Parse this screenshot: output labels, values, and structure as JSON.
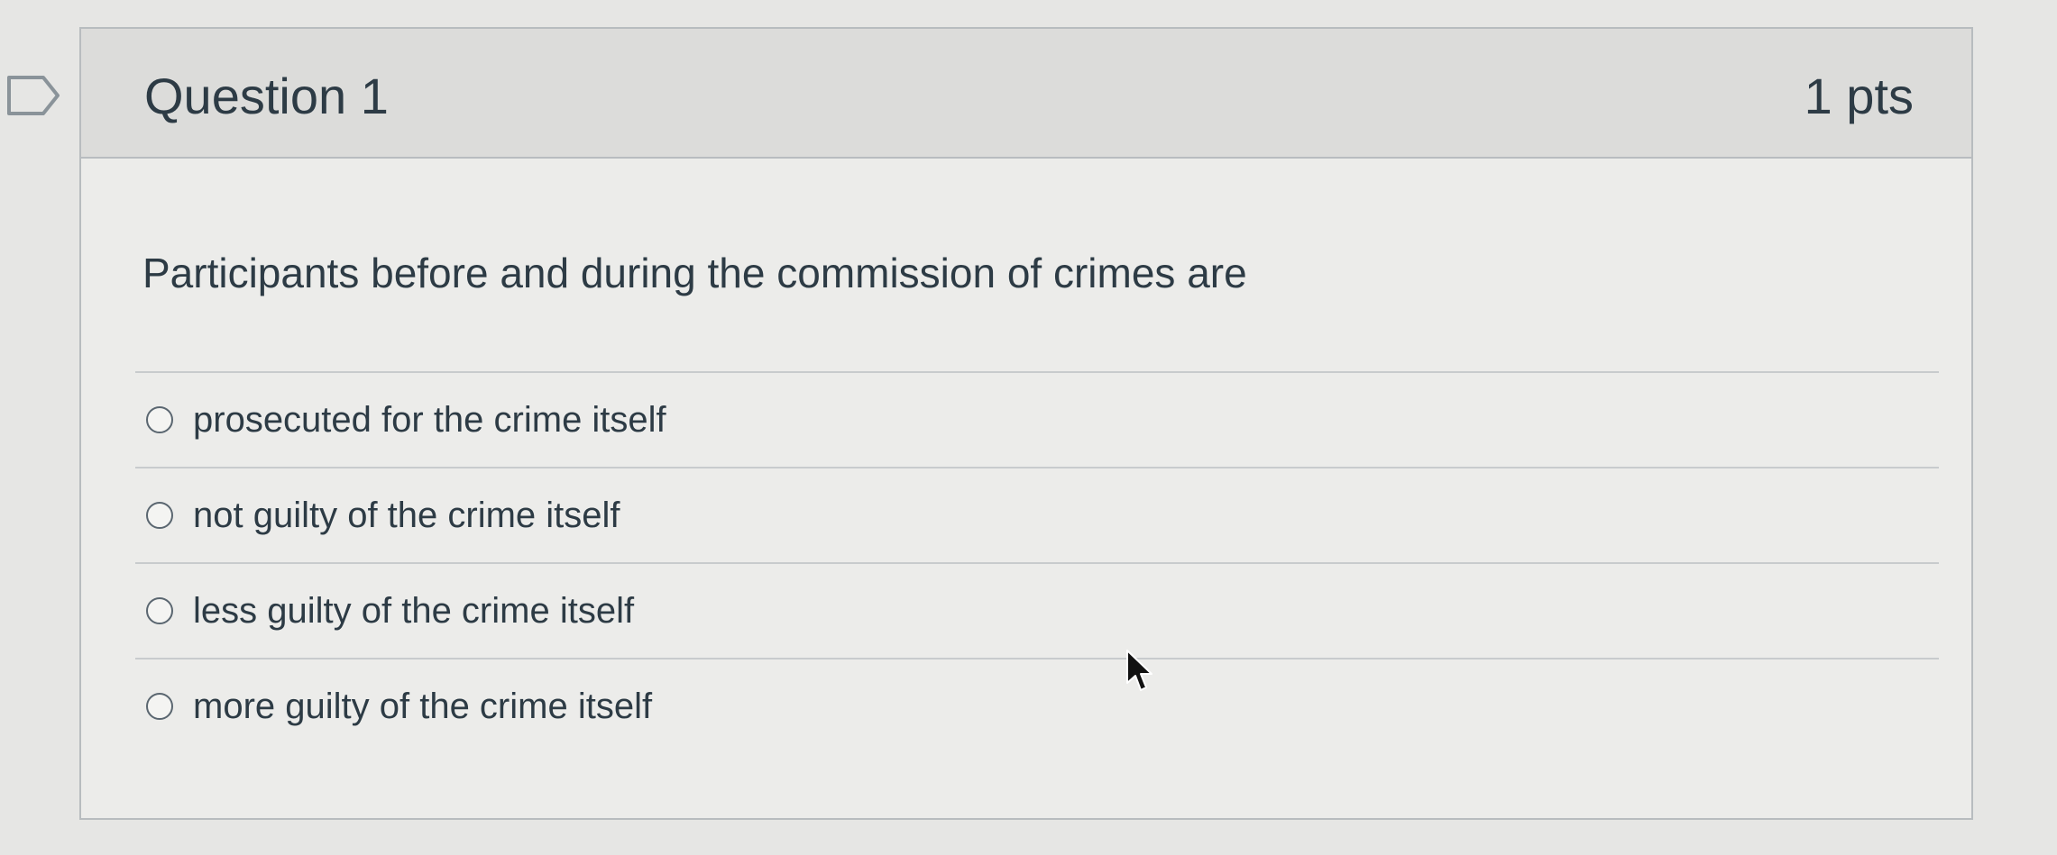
{
  "question": {
    "title": "Question 1",
    "points": "1 pts",
    "text": "Participants before and during the commission of crimes are",
    "answers": [
      {
        "label": "prosecuted for the crime itself",
        "selected": false
      },
      {
        "label": "not guilty of the crime itself",
        "selected": false
      },
      {
        "label": "less guilty of the crime itself",
        "selected": false
      },
      {
        "label": "more guilty of the crime itself",
        "selected": false
      }
    ]
  },
  "icons": {
    "flag": "flag-question-icon",
    "cursor": "mouse-pointer-icon"
  },
  "colors": {
    "text": "#2d3b45",
    "border": "#b8bcbf",
    "header_bg": "#dcdcda",
    "card_bg": "#ececea"
  }
}
